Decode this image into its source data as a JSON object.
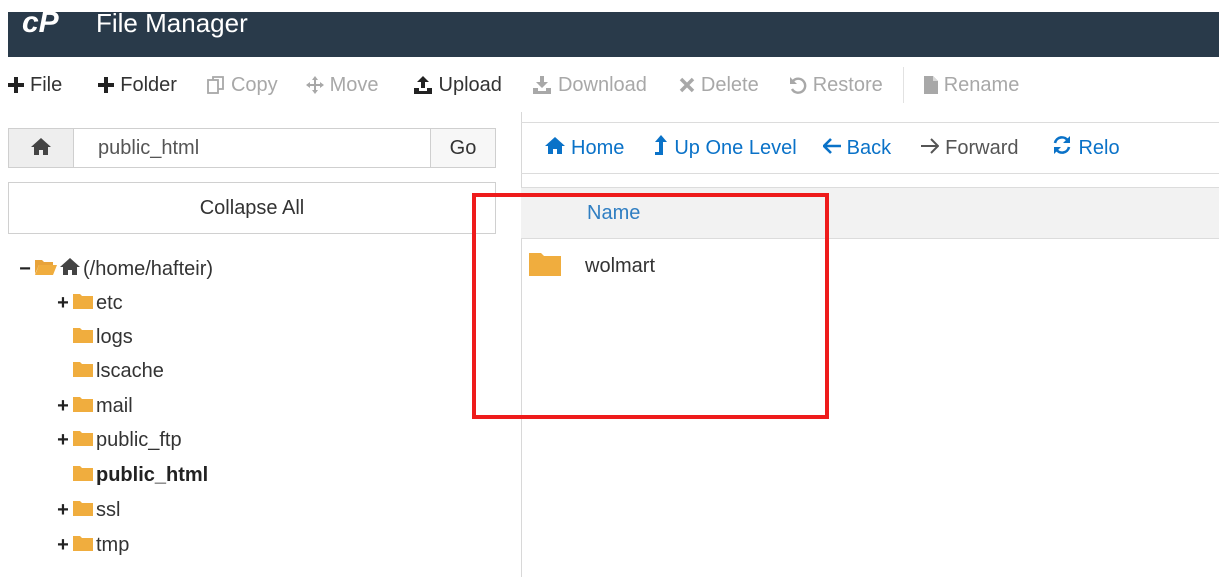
{
  "app": {
    "title": "File Manager",
    "logo_text": "cP"
  },
  "toolbar": {
    "file": "File",
    "folder": "Folder",
    "copy": "Copy",
    "move": "Move",
    "upload": "Upload",
    "download": "Download",
    "delete": "Delete",
    "restore": "Restore",
    "rename": "Rename"
  },
  "sidebar": {
    "path_value": "public_html",
    "go_label": "Go",
    "collapse_label": "Collapse All",
    "tree": {
      "root": "(/home/hafteir)",
      "items": [
        "etc",
        "logs",
        "lscache",
        "mail",
        "public_ftp",
        "public_html",
        "ssl",
        "tmp"
      ]
    }
  },
  "nav": {
    "home": "Home",
    "up": "Up One Level",
    "back": "Back",
    "forward": "Forward",
    "reload": "Relo"
  },
  "table": {
    "column_name": "Name",
    "rows": [
      {
        "name": "wolmart",
        "type": "folder"
      }
    ]
  },
  "colors": {
    "titlebar": "#293a4a",
    "link": "#0a72c8",
    "folder": "#f0ad3e",
    "highlight": "#ee1b1b"
  }
}
